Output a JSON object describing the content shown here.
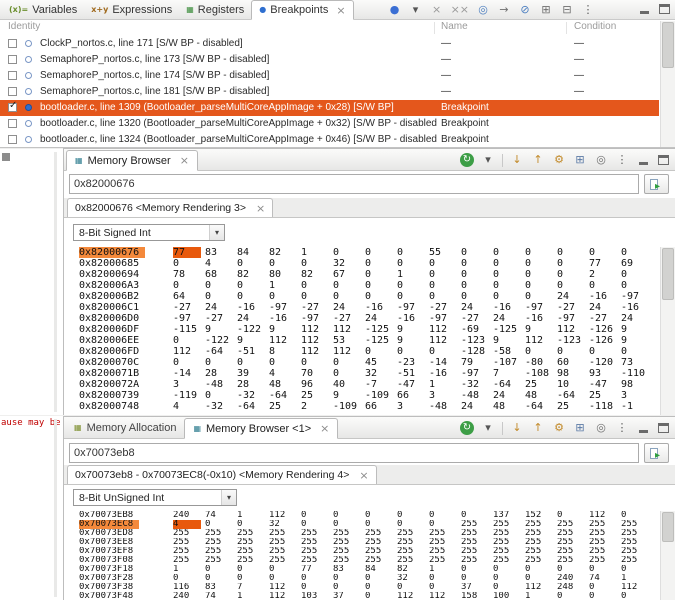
{
  "glyphs": {
    "caret_down": "▾",
    "go_arrow": "▸",
    "close": "×"
  },
  "colors": {
    "selection": "#e4571c",
    "address_highlight": "#f4893b",
    "cell_selected": "#e8590c",
    "error_text": "#c00000"
  },
  "left_gutter": {
    "error_text": "ause may be"
  },
  "memory_toolbar": [
    {
      "name": "refresh-icon",
      "glyph": "↻",
      "fg": "#ffffff",
      "bg": "#3d9e46"
    },
    {
      "name": "refresh-dropdown-icon",
      "glyph": "▾",
      "fg": "#555555"
    },
    {
      "name": "toolbar-separator",
      "sep": true
    },
    {
      "name": "save-memory-icon",
      "glyph": "↓",
      "fg": "#c28a2a"
    },
    {
      "name": "load-memory-icon",
      "glyph": "↑",
      "fg": "#c28a2a"
    },
    {
      "name": "fill-memory-icon",
      "glyph": "⚙",
      "fg": "#c28a2a"
    },
    {
      "name": "new-tab-icon",
      "glyph": "⊞",
      "fg": "#5b7aa6"
    },
    {
      "name": "pin-view-icon",
      "glyph": "◎",
      "fg": "#6f6f6f"
    },
    {
      "name": "view-menu-icon",
      "glyph": "⋮",
      "fg": "#555555"
    }
  ],
  "top_panel": {
    "tabs": [
      {
        "label": "Variables",
        "icon": "variables-icon",
        "glyph": "(x)=",
        "color": "#6b8f2e",
        "active": false,
        "closable": false
      },
      {
        "label": "Expressions",
        "icon": "expressions-icon",
        "glyph": "x+y",
        "color": "#a06a1e",
        "active": false,
        "closable": false
      },
      {
        "label": "Registers",
        "icon": "registers-icon",
        "glyph": "▦",
        "color": "#3a8c3a",
        "active": false,
        "closable": false
      },
      {
        "label": "Breakpoints",
        "icon": "breakpoints-icon",
        "glyph": "●",
        "color": "#2f6fd0",
        "active": true,
        "closable": true
      }
    ],
    "toolbar": [
      {
        "name": "new-breakpoint-icon",
        "glyph": "●",
        "fg": "#3b6fd4"
      },
      {
        "name": "breakpoint-menu-dropdown-icon",
        "glyph": "▾",
        "fg": "#555555"
      },
      {
        "name": "remove-breakpoint-icon",
        "glyph": "×",
        "fg": "#9a9a9a"
      },
      {
        "name": "remove-all-breakpoints-icon",
        "glyph": "××",
        "fg": "#9a9a9a"
      },
      {
        "name": "show-supported-breakpoints-icon",
        "glyph": "◎",
        "fg": "#4a7dbf"
      },
      {
        "name": "goto-file-icon",
        "glyph": "→",
        "fg": "#6f6f6f"
      },
      {
        "name": "skip-all-breakpoints-icon",
        "glyph": "⊘",
        "fg": "#4a7dbf"
      },
      {
        "name": "expand-all-icon",
        "glyph": "⊞",
        "fg": "#6f6f6f"
      },
      {
        "name": "collapse-all-icon",
        "glyph": "⊟",
        "fg": "#6f6f6f"
      },
      {
        "name": "view-menu-icon",
        "glyph": "⋮",
        "fg": "#555555"
      }
    ],
    "columns": [
      "Identity",
      "Name",
      "Condition"
    ],
    "rows": [
      {
        "checked": false,
        "selected": false,
        "identity": "ClockP_nortos.c, line 171 [S/W BP - disabled]",
        "name": "—",
        "condition": "—"
      },
      {
        "checked": false,
        "selected": false,
        "identity": "SemaphoreP_nortos.c, line 173 [S/W BP - disabled]",
        "name": "—",
        "condition": "—"
      },
      {
        "checked": false,
        "selected": false,
        "identity": "SemaphoreP_nortos.c, line 174 [S/W BP - disabled]",
        "name": "—",
        "condition": "—"
      },
      {
        "checked": false,
        "selected": false,
        "identity": "SemaphoreP_nortos.c, line 181 [S/W BP - disabled]",
        "name": "—",
        "condition": "—"
      },
      {
        "checked": true,
        "selected": true,
        "identity": "bootloader.c, line 1309 (Bootloader_parseMultiCoreAppImage + 0x28)  [S/W BP]",
        "name": "Breakpoint",
        "condition": ""
      },
      {
        "checked": false,
        "selected": false,
        "identity": "bootloader.c, line 1320 (Bootloader_parseMultiCoreAppImage + 0x32) [S/W BP - disabled]",
        "name": "Breakpoint",
        "condition": ""
      },
      {
        "checked": false,
        "selected": false,
        "identity": "bootloader.c, line 1324 (Bootloader_parseMultiCoreAppImage + 0x46) [S/W BP - disabled]",
        "name": "Breakpoint",
        "condition": ""
      }
    ]
  },
  "middle_panel": {
    "tabs": [
      {
        "label": "Memory Browser",
        "icon": "memory-browser-icon",
        "glyph": "▦",
        "color": "#2e7d8f",
        "active": true,
        "closable": true
      }
    ],
    "address_value": "0x82000676",
    "rendering_tab": "0x82000676 <Memory Rendering 3>",
    "format": "8-Bit Signed Int",
    "memory_rows": [
      {
        "addr": "0x82000676",
        "hl": true,
        "sel": 0,
        "values": [
          "77",
          "83",
          "84",
          "82",
          "1",
          "0",
          "0",
          "0",
          "55",
          "0",
          "0",
          "0",
          "0",
          "0",
          "0"
        ]
      },
      {
        "addr": "0x82000685",
        "values": [
          "0",
          "4",
          "0",
          "0",
          "0",
          "32",
          "0",
          "0",
          "0",
          "0",
          "0",
          "0",
          "0",
          "77",
          "69"
        ]
      },
      {
        "addr": "0x82000694",
        "values": [
          "78",
          "68",
          "82",
          "80",
          "82",
          "67",
          "0",
          "1",
          "0",
          "0",
          "0",
          "0",
          "0",
          "2",
          "0"
        ]
      },
      {
        "addr": "0x820006A3",
        "values": [
          "0",
          "0",
          "0",
          "1",
          "0",
          "0",
          "0",
          "0",
          "0",
          "0",
          "0",
          "0",
          "0",
          "0",
          "0"
        ]
      },
      {
        "addr": "0x820006B2",
        "values": [
          "64",
          "0",
          "0",
          "0",
          "0",
          "0",
          "0",
          "0",
          "0",
          "0",
          "0",
          "0",
          "24",
          "-16",
          "-97"
        ]
      },
      {
        "addr": "0x820006C1",
        "values": [
          "-27",
          "24",
          "-16",
          "-97",
          "-27",
          "24",
          "-16",
          "-97",
          "-27",
          "24",
          "-16",
          "-97",
          "-27",
          "24",
          "-16"
        ]
      },
      {
        "addr": "0x820006D0",
        "values": [
          "-97",
          "-27",
          "24",
          "-16",
          "-97",
          "-27",
          "24",
          "-16",
          "-97",
          "-27",
          "24",
          "-16",
          "-97",
          "-27",
          "24"
        ]
      },
      {
        "addr": "0x820006DF",
        "values": [
          "-115",
          "9",
          "-122",
          "9",
          "112",
          "112",
          "-125",
          "9",
          "112",
          "-69",
          "-125",
          "9",
          "112",
          "-126",
          "9"
        ]
      },
      {
        "addr": "0x820006EE",
        "values": [
          "0",
          "-122",
          "9",
          "112",
          "112",
          "53",
          "-125",
          "9",
          "112",
          "-123",
          "9",
          "112",
          "-123",
          "-126",
          "9"
        ]
      },
      {
        "addr": "0x820006FD",
        "values": [
          "112",
          "-64",
          "-51",
          "8",
          "112",
          "112",
          "0",
          "0",
          "0",
          "-128",
          "-58",
          "0",
          "0",
          "0",
          "0"
        ]
      },
      {
        "addr": "0x8200070C",
        "values": [
          "0",
          "0",
          "0",
          "0",
          "0",
          "0",
          "45",
          "-23",
          "-14",
          "79",
          "-107",
          "-80",
          "60",
          "-120",
          "73"
        ]
      },
      {
        "addr": "0x8200071B",
        "values": [
          "-14",
          "28",
          "39",
          "4",
          "70",
          "0",
          "32",
          "-51",
          "-16",
          "-97",
          "7",
          "-108",
          "98",
          "93",
          "-110"
        ]
      },
      {
        "addr": "0x8200072A",
        "values": [
          "3",
          "-48",
          "28",
          "48",
          "96",
          "40",
          "-7",
          "-47",
          "1",
          "-32",
          "-64",
          "25",
          "10",
          "-47",
          "98"
        ]
      },
      {
        "addr": "0x82000739",
        "values": [
          "-119",
          "0",
          "-32",
          "-64",
          "25",
          "9",
          "-109",
          "66",
          "3",
          "-48",
          "24",
          "48",
          "-64",
          "25",
          "3"
        ]
      },
      {
        "addr": "0x82000748",
        "values": [
          "4",
          "-32",
          "-64",
          "25",
          "2",
          "-109",
          "66",
          "3",
          "-48",
          "24",
          "48",
          "-64",
          "25",
          "-118",
          "-1"
        ]
      }
    ]
  },
  "bottom_panel": {
    "tabs": [
      {
        "label": "Memory Allocation",
        "icon": "memory-allocation-icon",
        "glyph": "▦",
        "color": "#7d8f2e",
        "active": false,
        "closable": false
      },
      {
        "label": "Memory Browser <1>",
        "icon": "memory-browser-icon",
        "glyph": "▦",
        "color": "#2e7d8f",
        "active": true,
        "closable": true
      }
    ],
    "address_value": "0x70073eb8",
    "rendering_tab": "0x70073eb8 - 0x70073EC8(-0x10) <Memory Rendering 4>",
    "format": "8-Bit UnSigned Int",
    "memory_rows": [
      {
        "addr": "0x70073EB8",
        "values": [
          "240",
          "74",
          "1",
          "112",
          "0",
          "0",
          "0",
          "0",
          "0",
          "0",
          "137",
          "152",
          "0",
          "112",
          "0"
        ]
      },
      {
        "addr": "0x70073EC8",
        "hl": true,
        "sel": 0,
        "values": [
          "4",
          "0",
          "0",
          "32",
          "0",
          "0",
          "0",
          "0",
          "0",
          "255",
          "255",
          "255",
          "255",
          "255",
          "255"
        ]
      },
      {
        "addr": "0x70073ED8",
        "values": [
          "255",
          "255",
          "255",
          "255",
          "255",
          "255",
          "255",
          "255",
          "255",
          "255",
          "255",
          "255",
          "255",
          "255",
          "255"
        ]
      },
      {
        "addr": "0x70073EE8",
        "values": [
          "255",
          "255",
          "255",
          "255",
          "255",
          "255",
          "255",
          "255",
          "255",
          "255",
          "255",
          "255",
          "255",
          "255",
          "255"
        ]
      },
      {
        "addr": "0x70073EF8",
        "values": [
          "255",
          "255",
          "255",
          "255",
          "255",
          "255",
          "255",
          "255",
          "255",
          "255",
          "255",
          "255",
          "255",
          "255",
          "255"
        ]
      },
      {
        "addr": "0x70073F08",
        "values": [
          "255",
          "255",
          "255",
          "255",
          "255",
          "255",
          "255",
          "255",
          "255",
          "255",
          "255",
          "255",
          "255",
          "255",
          "255"
        ]
      },
      {
        "addr": "0x70073F18",
        "values": [
          "1",
          "0",
          "0",
          "0",
          "77",
          "83",
          "84",
          "82",
          "1",
          "0",
          "0",
          "0",
          "0",
          "0",
          "0"
        ]
      },
      {
        "addr": "0x70073F28",
        "values": [
          "0",
          "0",
          "0",
          "0",
          "0",
          "0",
          "0",
          "32",
          "0",
          "0",
          "0",
          "0",
          "240",
          "74",
          "1"
        ]
      },
      {
        "addr": "0x70073F38",
        "values": [
          "116",
          "83",
          "7",
          "112",
          "0",
          "0",
          "0",
          "0",
          "0",
          "37",
          "0",
          "112",
          "248",
          "0",
          "112"
        ]
      },
      {
        "addr": "0x70073F48",
        "values": [
          "240",
          "74",
          "1",
          "112",
          "103",
          "37",
          "0",
          "112",
          "112",
          "158",
          "100",
          "1",
          "0",
          "0",
          "0"
        ]
      }
    ]
  }
}
